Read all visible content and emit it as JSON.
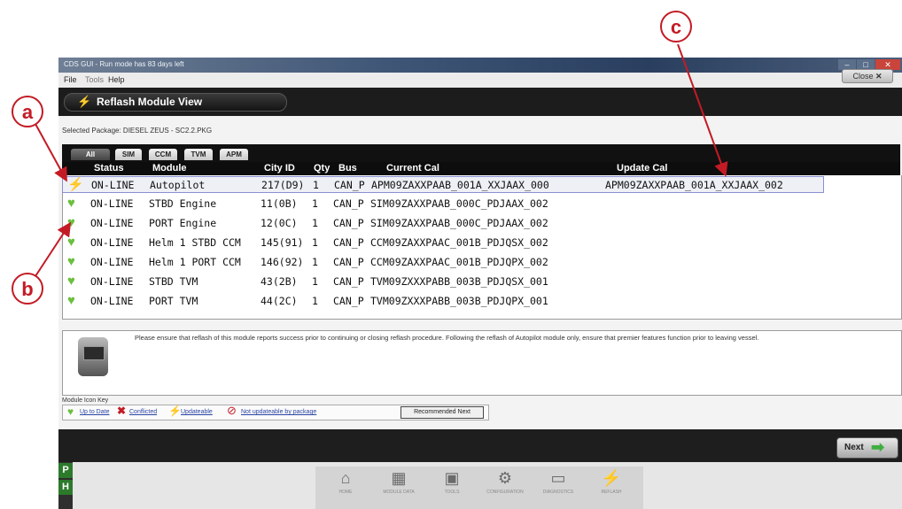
{
  "window": {
    "title": "CDS GUI - Run mode has 83 days left"
  },
  "menu": [
    "File",
    "Tools",
    "Help"
  ],
  "header": {
    "title": "Reflash Module View",
    "close_label": "Close"
  },
  "selected_package": "Selected Package: DIESEL ZEUS - SC2.2.PKG",
  "tabs": [
    "All Modules",
    "SIM",
    "CCM",
    "TVM",
    "APM"
  ],
  "columns": {
    "status": "Status",
    "module": "Module",
    "city_id": "City ID",
    "qty": "Qty",
    "bus": "Bus",
    "current_cal": "Current Cal",
    "update_cal": "Update Cal"
  },
  "rows": [
    {
      "icon": "bolt-icon",
      "status": "ON-LINE",
      "module": "Autopilot",
      "city_id": "217(D9)",
      "qty": "1",
      "bus": "CAN_P",
      "current_cal": "APM09ZAXXPAAB_001A_XXJAAX_000",
      "update_cal": "APM09ZAXXPAAB_001A_XXJAAX_002"
    },
    {
      "icon": "heart-check-icon",
      "status": "ON-LINE",
      "module": "STBD Engine",
      "city_id": "11(0B)",
      "qty": "1",
      "bus": "CAN_P",
      "current_cal": "SIM09ZAXXPAAB_000C_PDJAAX_002",
      "update_cal": ""
    },
    {
      "icon": "heart-check-icon",
      "status": "ON-LINE",
      "module": "PORT Engine",
      "city_id": "12(0C)",
      "qty": "1",
      "bus": "CAN_P",
      "current_cal": "SIM09ZAXXPAAB_000C_PDJAAX_002",
      "update_cal": ""
    },
    {
      "icon": "heart-check-icon",
      "status": "ON-LINE",
      "module": "Helm 1 STBD CCM",
      "city_id": "145(91)",
      "qty": "1",
      "bus": "CAN_P",
      "current_cal": "CCM09ZAXXPAAC_001B_PDJQSX_002",
      "update_cal": ""
    },
    {
      "icon": "heart-check-icon",
      "status": "ON-LINE",
      "module": "Helm 1 PORT CCM",
      "city_id": "146(92)",
      "qty": "1",
      "bus": "CAN_P",
      "current_cal": "CCM09ZAXXPAAC_001B_PDJQPX_002",
      "update_cal": ""
    },
    {
      "icon": "heart-check-icon",
      "status": "ON-LINE",
      "module": "STBD TVM",
      "city_id": "43(2B)",
      "qty": "1",
      "bus": "CAN_P",
      "current_cal": "TVM09ZXXXPABB_003B_PDJQSX_001",
      "update_cal": ""
    },
    {
      "icon": "heart-check-icon",
      "status": "ON-LINE",
      "module": "PORT TVM",
      "city_id": "44(2C)",
      "qty": "1",
      "bus": "CAN_P",
      "current_cal": "TVM09ZXXXPABB_003B_PDJQPX_001",
      "update_cal": ""
    }
  ],
  "notice": "Please ensure that reflash of this module reports success prior to continuing or closing reflash procedure. Following the reflash of Autopilot module only, ensure that premier features function prior to leaving vessel.",
  "key": {
    "title": "Module Icon Key",
    "up_to_date": "Up to Date",
    "conflicted": "Conflicted",
    "updateable": "Updateable",
    "not_updateable": "Not updateable by package",
    "recommended": "Recommended Next"
  },
  "next_label": "Next",
  "side_buttons": [
    "P",
    "H"
  ],
  "dock": [
    "Home",
    "Module Data",
    "Tools",
    "Configuration",
    "Diagnostics",
    "Reflash"
  ],
  "callouts": {
    "a": "a",
    "b": "b",
    "c": "c"
  },
  "colors": {
    "accent_red": "#c31b25",
    "ok_green": "#6cbf3f",
    "bolt_yellow": "#e3cf17"
  }
}
